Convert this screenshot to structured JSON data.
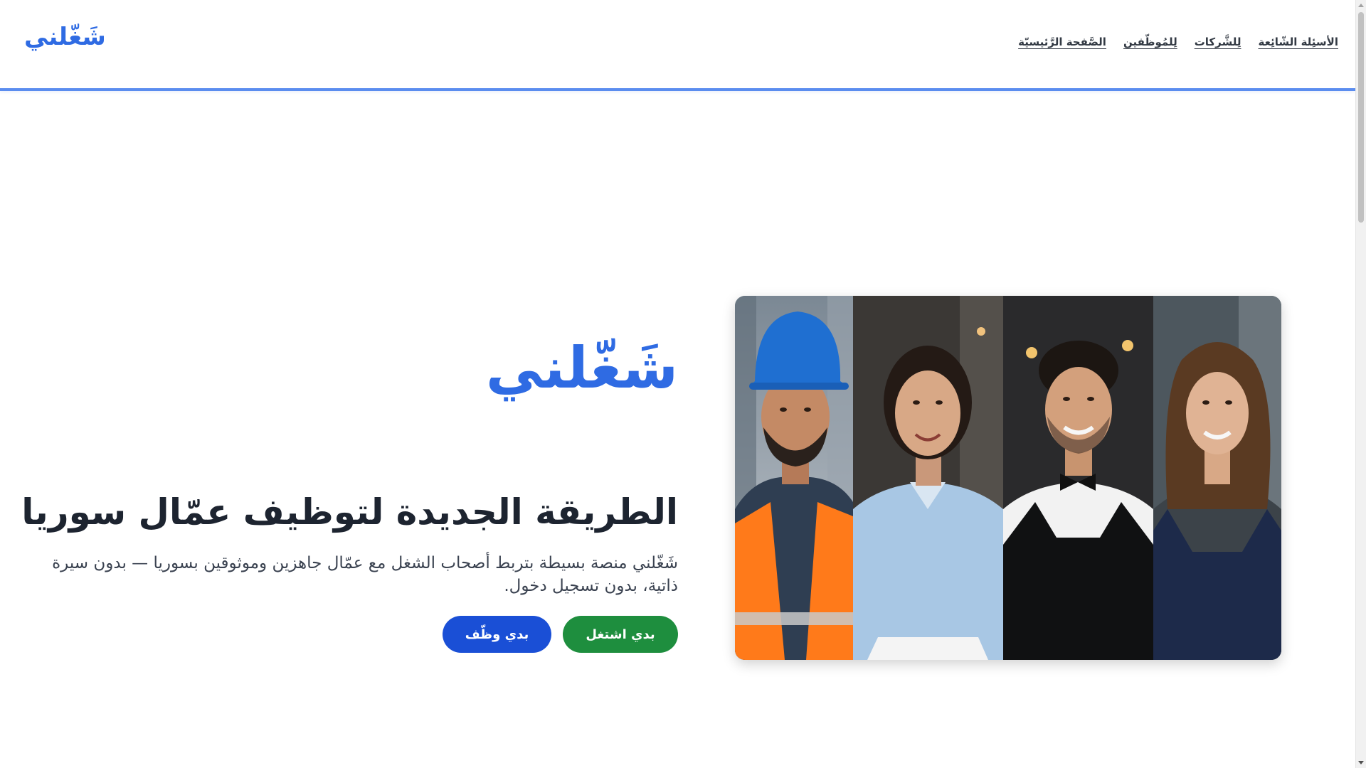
{
  "header": {
    "logo": "شَغّلني",
    "nav": [
      {
        "label": "الصَّفحة الرَّئيسيّة"
      },
      {
        "label": "لِلمُوظّفين"
      },
      {
        "label": "لِلشَّركات"
      },
      {
        "label": "الأسئِلة الشّائِعة"
      }
    ]
  },
  "hero": {
    "logo": "شَغّلني",
    "title": "الطريقة الجديدة لتوظيف عمّال سوريا",
    "description": "شَغّلني منصة بسيطة بتربط أصحاب الشغل مع عمّال جاهزين وموثوقين بسوريا — بدون سيرة ذاتية، بدون تسجيل دخول.",
    "buttons": {
      "work": "بدي اشتغل",
      "hire": "بدي وظّف"
    }
  },
  "photo_panel": {
    "people": [
      {
        "icon": "construction-worker-photo"
      },
      {
        "icon": "housekeeper-photo"
      },
      {
        "icon": "waiter-photo"
      },
      {
        "icon": "barista-photo"
      }
    ]
  },
  "colors": {
    "brand_blue": "#2f6be3",
    "button_green": "#1e8e3e",
    "button_blue": "#1a4fd6",
    "header_border": "#5b8def"
  }
}
